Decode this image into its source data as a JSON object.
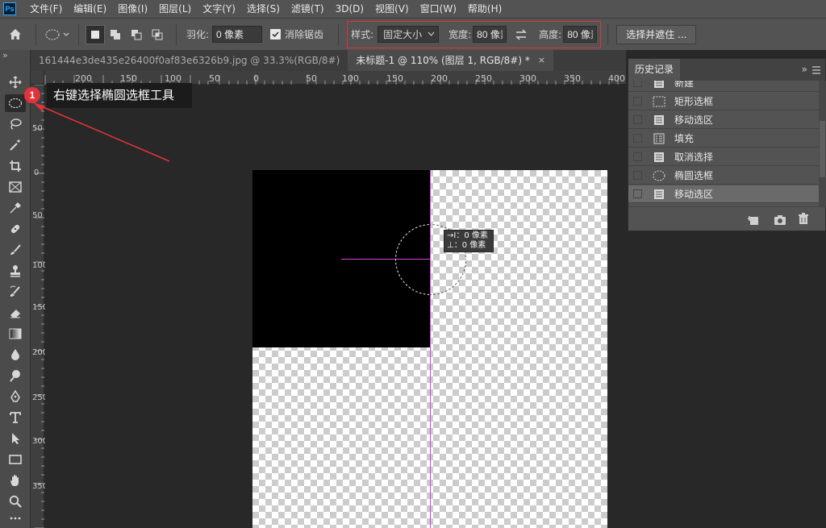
{
  "app": {
    "logo_text": "Ps"
  },
  "menu": [
    "文件(F)",
    "编辑(E)",
    "图像(I)",
    "图层(L)",
    "文字(Y)",
    "选择(S)",
    "滤镜(T)",
    "3D(D)",
    "视图(V)",
    "窗口(W)",
    "帮助(H)"
  ],
  "options": {
    "feather_label": "羽化:",
    "feather_value": "0 像素",
    "antialias_label": "消除锯齿",
    "antialias_checked": true,
    "style_label": "样式:",
    "style_value": "固定大小",
    "width_label": "宽度:",
    "width_value": "80 像素",
    "height_label": "高度:",
    "height_value": "80 像素",
    "select_mask_label": "选择并遮住 ..."
  },
  "tabs": [
    {
      "title": "161444e3de435e26400f0af83e6326b9.jpg @ 33.3%(RGB/8#)",
      "active": false
    },
    {
      "title": "未标题-1 @ 110% (图层 1, RGB/8#) *",
      "active": true,
      "close": "×"
    }
  ],
  "ruler": {
    "h_labels": [
      "200",
      "150",
      "100",
      "50",
      "0",
      "50",
      "100",
      "150",
      "200",
      "250",
      "300",
      "350",
      "400"
    ],
    "v_labels": [
      "50",
      "0",
      "50",
      "100",
      "150",
      "200",
      "250",
      "300",
      "350"
    ]
  },
  "tools": [
    "move-tool-icon",
    "elliptical-marquee-icon",
    "lasso-icon",
    "magic-wand-icon",
    "crop-icon",
    "frame-icon",
    "eyedropper-icon",
    "healing-brush-icon",
    "brush-icon",
    "clone-stamp-icon",
    "history-brush-icon",
    "eraser-icon",
    "gradient-icon",
    "blur-icon",
    "dodge-icon",
    "pen-icon",
    "type-icon",
    "path-select-icon",
    "rectangle-icon",
    "hand-icon",
    "zoom-icon",
    "more-icon"
  ],
  "annotation": {
    "badge": "1",
    "text": "右键选择椭圆选框工具",
    "accent": "#e0343a"
  },
  "tooltip": {
    "line1": "→I：0 像素",
    "line2": "⊥：0 像素"
  },
  "history": {
    "title": "历史记录",
    "items": [
      {
        "label": "新建",
        "icon": "document-icon"
      },
      {
        "label": "矩形选框",
        "icon": "rect-marquee-icon"
      },
      {
        "label": "移动选区",
        "icon": "document-icon"
      },
      {
        "label": "填充",
        "icon": "fill-icon"
      },
      {
        "label": "取消选择",
        "icon": "document-icon"
      },
      {
        "label": "椭圆选框",
        "icon": "ellipse-marquee-icon"
      },
      {
        "label": "移动选区",
        "icon": "document-icon"
      }
    ]
  },
  "colors": {
    "guide": "#e040e0",
    "ui_dark": "#282828",
    "ui_panel": "#535353"
  }
}
